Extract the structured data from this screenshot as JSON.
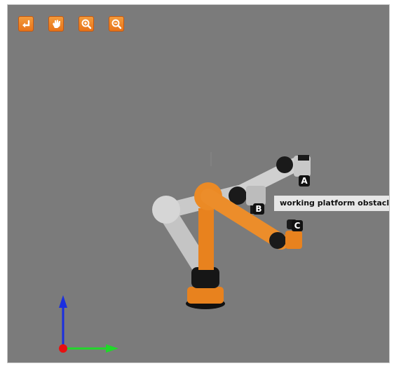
{
  "toolbar": {
    "buttons": [
      {
        "name": "rotate-left-button",
        "icon": "rotate-left-icon"
      },
      {
        "name": "pan-hand-button",
        "icon": "hand-icon"
      },
      {
        "name": "zoom-in-button",
        "icon": "zoom-in-icon"
      },
      {
        "name": "zoom-out-button",
        "icon": "zoom-out-icon"
      }
    ]
  },
  "markers": {
    "a": "A",
    "b": "B",
    "c": "C"
  },
  "annotation": "working platform obstacles",
  "colors": {
    "viewport_bg": "#7b7b7b",
    "robot_orange": "#e8821e",
    "robot_grey": "#d2d2d2",
    "accent_button": "#ef8a27"
  }
}
